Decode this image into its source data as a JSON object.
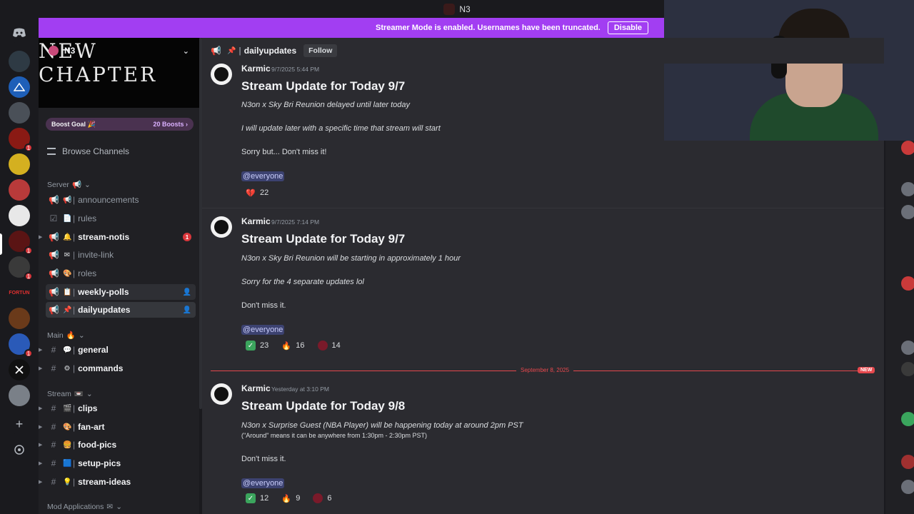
{
  "titlebar": {
    "server_name": "N3"
  },
  "banner": {
    "text": "Streamer Mode is enabled. Usernames have been truncated.",
    "button_label": "Disable"
  },
  "rail": {
    "badges": [
      "1",
      "1",
      "1",
      "1"
    ]
  },
  "server": {
    "name": "N3",
    "banner_text": "NEW CHAPTER",
    "boost_label": "Boost Goal 🎉",
    "boost_count": "20 Boosts ›",
    "browse_label": "Browse Channels"
  },
  "categories": {
    "server": "Server",
    "main": "Main",
    "stream": "Stream",
    "mod": "Mod Applications"
  },
  "channels": {
    "server": [
      {
        "emoji": "📢",
        "name": "announcements",
        "type": "announce"
      },
      {
        "emoji": "📄",
        "name": "rules",
        "type": "rules"
      },
      {
        "emoji": "🔔",
        "name": "stream-notis",
        "type": "announce",
        "badge": "1"
      },
      {
        "emoji": "✉",
        "name": "invite-link",
        "type": "announce"
      },
      {
        "emoji": "🎨",
        "name": "roles",
        "type": "announce"
      },
      {
        "emoji": "📋",
        "name": "weekly-polls",
        "type": "announce"
      },
      {
        "emoji": "📌",
        "name": "dailyupdates",
        "type": "announce"
      }
    ],
    "main": [
      {
        "emoji": "💬",
        "name": "general"
      },
      {
        "emoji": "⚙",
        "name": "commands"
      }
    ],
    "stream": [
      {
        "emoji": "🎬",
        "name": "clips"
      },
      {
        "emoji": "🎨",
        "name": "fan-art"
      },
      {
        "emoji": "🍔",
        "name": "food-pics"
      },
      {
        "emoji": "🟦",
        "name": "setup-pics"
      },
      {
        "emoji": "💡",
        "name": "stream-ideas"
      }
    ]
  },
  "header": {
    "channel_name": "dailyupdates",
    "follow_label": "Follow"
  },
  "messages": [
    {
      "author": "Karmic",
      "time": "9/7/2025 5:44 PM",
      "title": "Stream Update for Today 9/7",
      "lines": [
        "N3on x Sky Bri Reunion delayed until later today",
        "I will update later with a specific time that stream will start",
        "Sorry but... Don't miss it!"
      ],
      "mention": "@everyone",
      "reactions": [
        {
          "emoji": "heart-broken",
          "count": "22"
        }
      ]
    },
    {
      "author": "Karmic",
      "time": "9/7/2025 7:14 PM",
      "title": "Stream Update for Today 9/7",
      "lines": [
        "N3on x Sky Bri Reunion will be starting in approximately 1 hour",
        "Sorry for the 4 separate updates lol",
        "Don't miss it."
      ],
      "mention": "@everyone",
      "reactions": [
        {
          "emoji": "check",
          "count": "23"
        },
        {
          "emoji": "fire",
          "count": "16"
        },
        {
          "emoji": "red",
          "count": "14"
        }
      ]
    },
    {
      "author": "Karmic",
      "time": "Yesterday at 3:10 PM",
      "title": "Stream Update for Today 9/8",
      "lines": [
        "N3on x Surprise Guest (NBA Player) will be happening today at around 2pm PST",
        "(\"Around\" means it can be anywhere from 1:30pm - 2:30pm PST)",
        "Don't miss it."
      ],
      "mention": "@everyone",
      "reactions": [
        {
          "emoji": "check",
          "count": "12"
        },
        {
          "emoji": "fire",
          "count": "9"
        },
        {
          "emoji": "red",
          "count": "6"
        }
      ]
    }
  ],
  "divider": {
    "label": "September 8, 2025",
    "new_label": "NEW"
  }
}
